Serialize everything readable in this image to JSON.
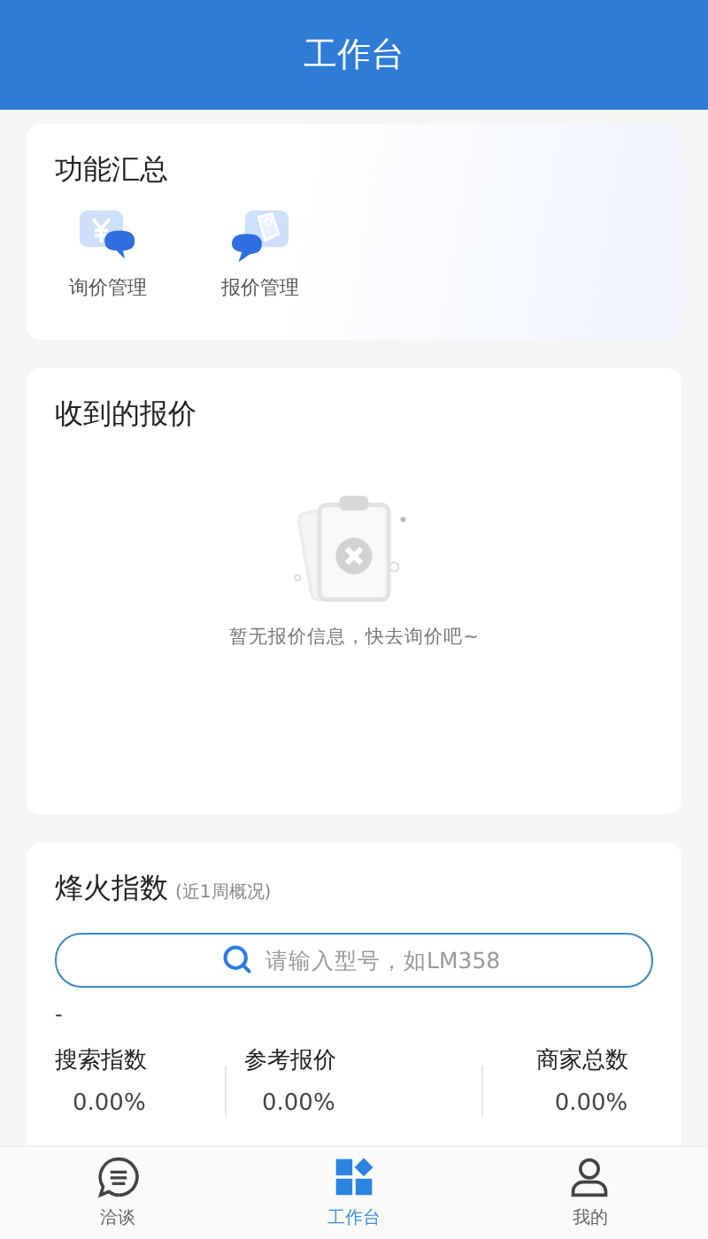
{
  "header": {
    "title": "工作台"
  },
  "functions": {
    "title": "功能汇总",
    "items": [
      {
        "kind": "inquiry",
        "label": "询价管理"
      },
      {
        "kind": "quote",
        "label": "报价管理"
      }
    ]
  },
  "quotes": {
    "title": "收到的报价",
    "empty_text": "暂无报价信息，快去询价吧~"
  },
  "index": {
    "title": "烽火指数",
    "subtitle": "(近1周概况)",
    "search": {
      "placeholder": "请输入型号，如LM358"
    },
    "model": "-",
    "stats": [
      {
        "label": "搜索指数",
        "value": "0.00%"
      },
      {
        "label": "参考报价",
        "value": "0.00%"
      },
      {
        "label": "商家总数",
        "value": "0.00%"
      }
    ]
  },
  "tabs": [
    {
      "kind": "chat",
      "label": "洽谈",
      "selected": false
    },
    {
      "kind": "workbench",
      "label": "工作台",
      "selected": true
    },
    {
      "kind": "profile",
      "label": "我的",
      "selected": false
    }
  ]
}
